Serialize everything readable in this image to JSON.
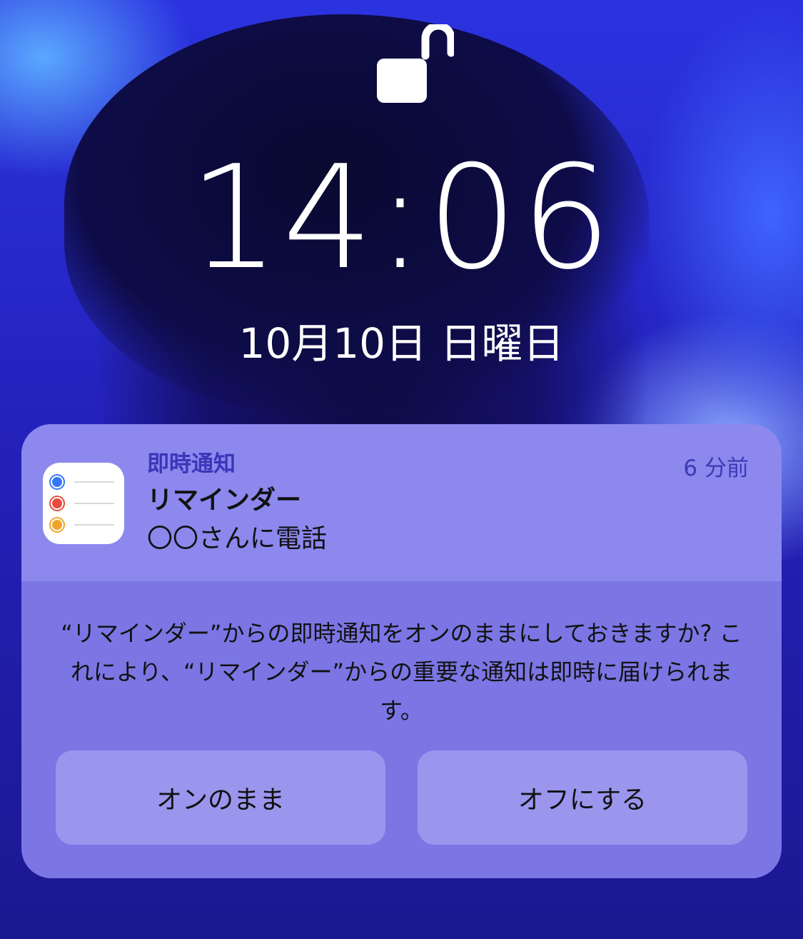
{
  "lockscreen": {
    "time": "14:06",
    "date": "10月10日 日曜日"
  },
  "notification": {
    "app_category": "即時通知",
    "time_ago": "6 分前",
    "title": "リマインダー",
    "body": "〇〇さんに電話",
    "icon": "reminders-app-icon",
    "icon_dot_colors": [
      "#3478f6",
      "#e94c3d",
      "#f0a528"
    ],
    "prompt": "“リマインダー”からの即時通知をオンのままにしておきますか? これにより、“リマインダー”からの重要な通知は即時に届けられます。",
    "buttons": {
      "keep_on": "オンのまま",
      "turn_off": "オフにする"
    }
  },
  "colors": {
    "card_top": "#8c88ee",
    "card_bottom": "#7b76e4",
    "button": "#9a96ee",
    "accent": "#3c35b8"
  }
}
